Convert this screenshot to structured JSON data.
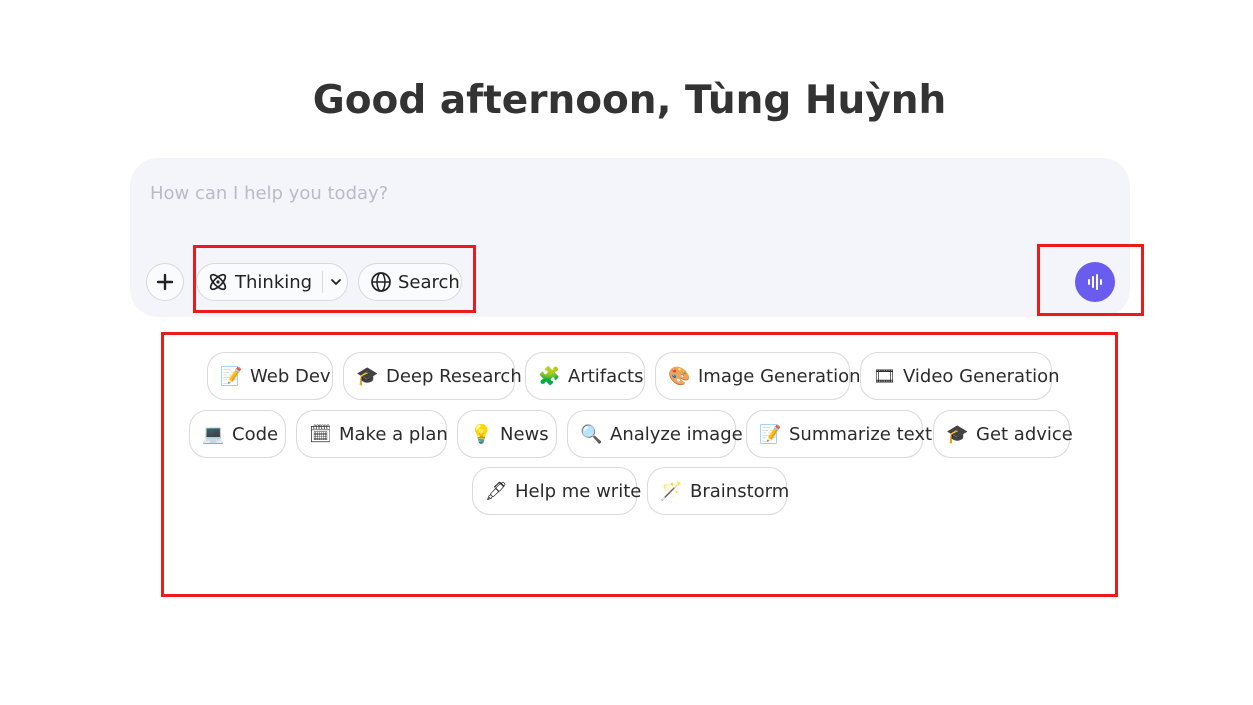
{
  "greeting": "Good afternoon, Tùng Huỳnh",
  "composer": {
    "placeholder": "How can I help you today?",
    "thinking_label": "Thinking",
    "search_label": "Search"
  },
  "icons": {
    "plus": "plus-icon",
    "thinking": "atom-icon",
    "chevron": "chevron-down-icon",
    "search": "globe-icon",
    "voice": "voice-wave-icon"
  },
  "colors": {
    "accent": "#6b5cf0",
    "composer_bg": "#f4f5fa",
    "highlight": "#ec1b1b"
  },
  "suggestions": [
    {
      "emoji": "📝",
      "label": "Web Dev"
    },
    {
      "emoji": "🎓",
      "label": "Deep Research"
    },
    {
      "emoji": "🧩",
      "label": "Artifacts"
    },
    {
      "emoji": "🎨",
      "label": "Image Generation"
    },
    {
      "emoji": "🎞",
      "label": "Video Generation"
    },
    {
      "emoji": "💻",
      "label": "Code"
    },
    {
      "emoji": "🗓",
      "label": "Make a plan"
    },
    {
      "emoji": "💡",
      "label": "News"
    },
    {
      "emoji": "🔍",
      "label": "Analyze image"
    },
    {
      "emoji": "📝",
      "label": "Summarize text"
    },
    {
      "emoji": "🎓",
      "label": "Get advice"
    },
    {
      "emoji": "🖋",
      "label": "Help me write"
    },
    {
      "emoji": "🪄",
      "label": "Brainstorm"
    }
  ]
}
